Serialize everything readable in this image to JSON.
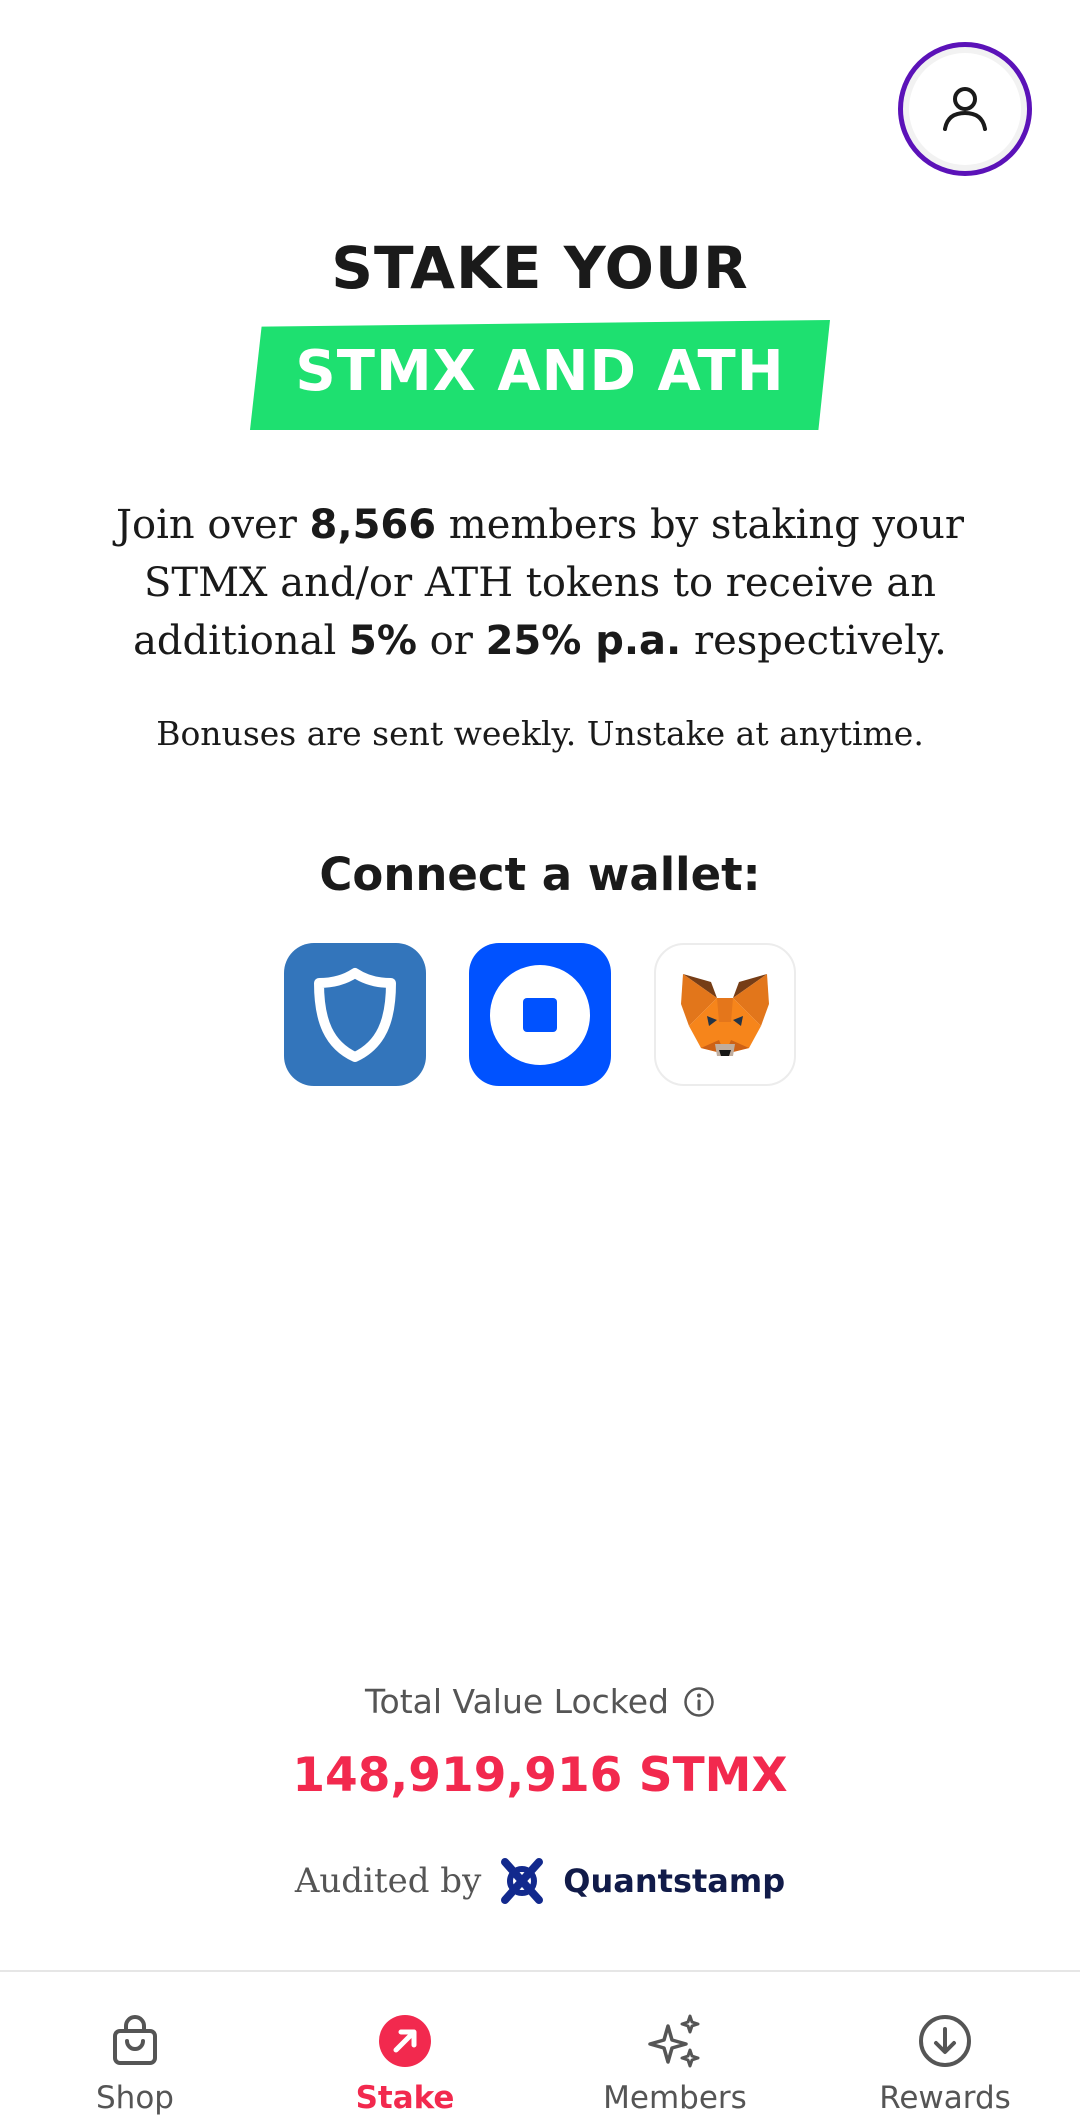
{
  "header": {
    "headline_line1": "STAKE YOUR",
    "headline_line2": "STMX AND ATH"
  },
  "intro": {
    "t1": "Join over ",
    "members_count": "8,566",
    "t2": " members by staking your STMX and/or ATH tokens to receive an additional ",
    "rate1": "5%",
    "t3": " or ",
    "rate2": "25% p.a.",
    "t4": " respectively."
  },
  "note": "Bonuses are sent weekly. Unstake at anytime.",
  "connect": {
    "title": "Connect a wallet:",
    "wallets": [
      "Trust Wallet",
      "Coinbase Wallet",
      "MetaMask"
    ]
  },
  "tvl": {
    "label": "Total Value Locked",
    "value": "148,919,916 STMX"
  },
  "audit": {
    "label": "Audited by",
    "auditor": "Quantstamp"
  },
  "tabs": [
    {
      "label": "Shop",
      "icon": "shopping-bag-icon",
      "active": false
    },
    {
      "label": "Stake",
      "icon": "stake-arrow-icon",
      "active": true
    },
    {
      "label": "Members",
      "icon": "sparkles-icon",
      "active": false
    },
    {
      "label": "Rewards",
      "icon": "download-circle-icon",
      "active": false
    }
  ],
  "colors": {
    "accent_red": "#f2294e",
    "highlight_green": "#1ee070",
    "profile_ring": "#5b12b8",
    "trust_blue": "#3375bb",
    "coinbase_blue": "#0052ff"
  }
}
